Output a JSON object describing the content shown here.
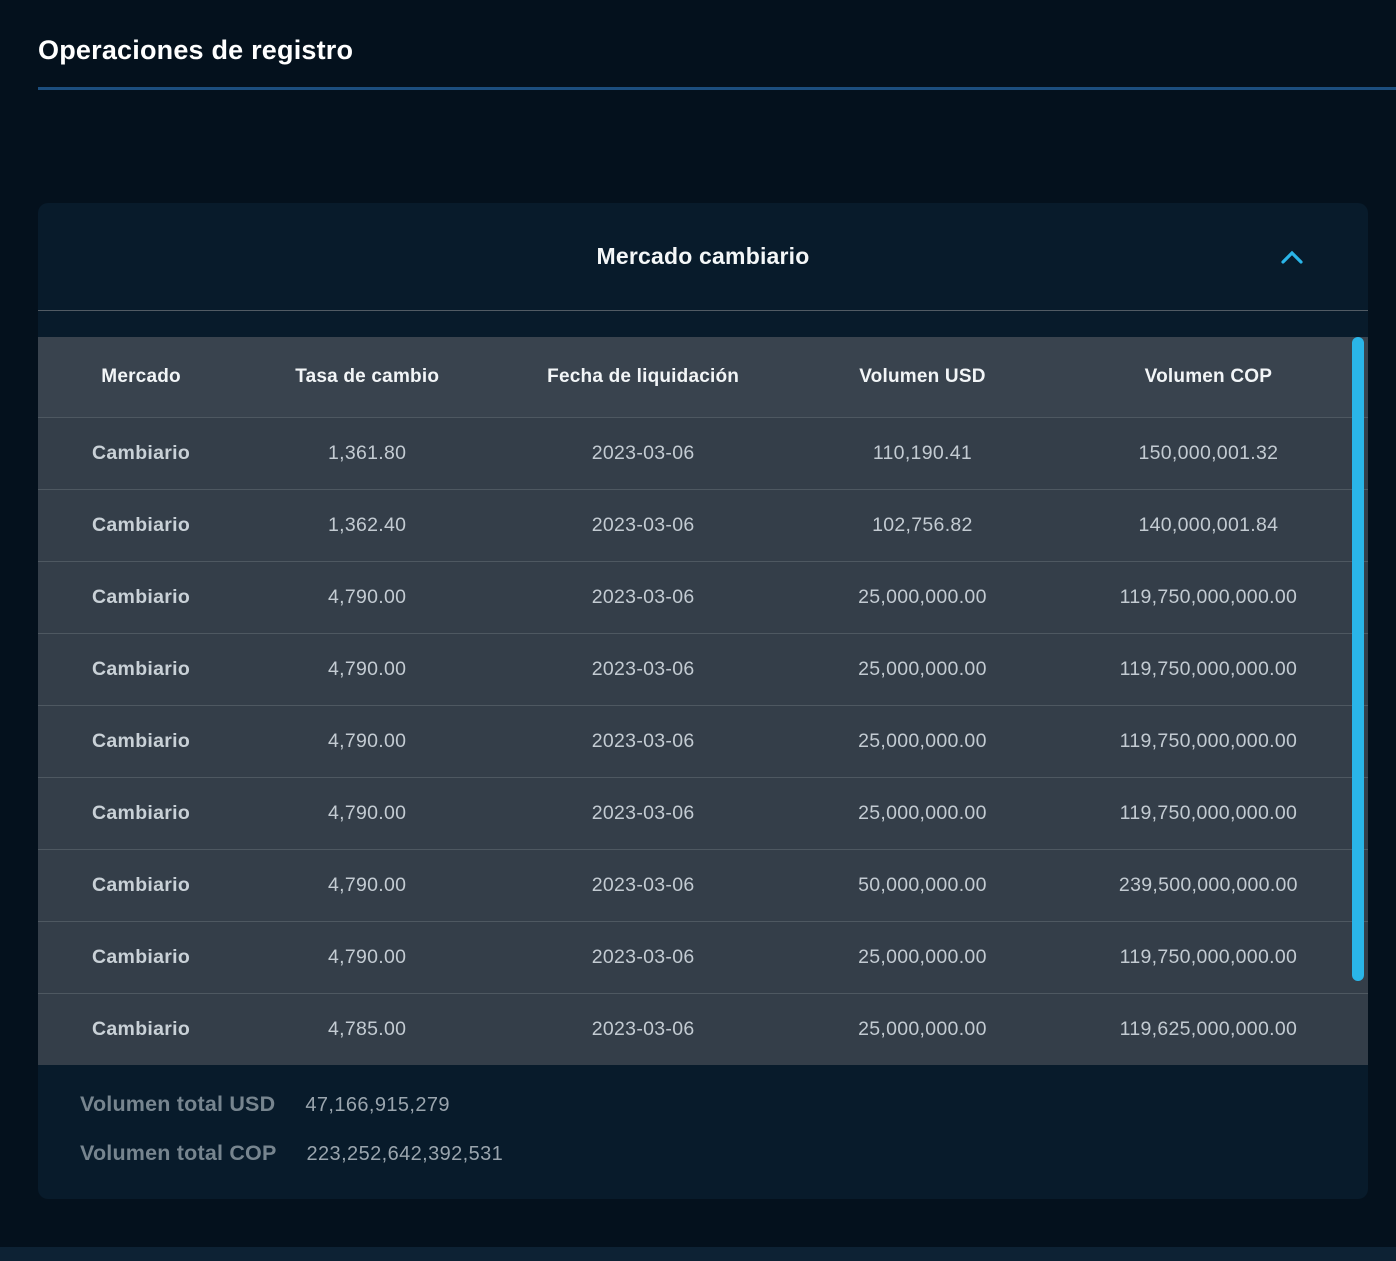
{
  "page": {
    "title": "Operaciones de registro"
  },
  "panel": {
    "title": "Mercado cambiario",
    "collapse_icon": "chevron-up",
    "accent_color": "#2ab5e8"
  },
  "table": {
    "headers": [
      "Mercado",
      "Tasa de cambio",
      "Fecha de liquidación",
      "Volumen USD",
      "Volumen COP"
    ],
    "rows": [
      [
        "Cambiario",
        "1,361.80",
        "2023-03-06",
        "110,190.41",
        "150,000,001.32"
      ],
      [
        "Cambiario",
        "1,362.40",
        "2023-03-06",
        "102,756.82",
        "140,000,001.84"
      ],
      [
        "Cambiario",
        "4,790.00",
        "2023-03-06",
        "25,000,000.00",
        "119,750,000,000.00"
      ],
      [
        "Cambiario",
        "4,790.00",
        "2023-03-06",
        "25,000,000.00",
        "119,750,000,000.00"
      ],
      [
        "Cambiario",
        "4,790.00",
        "2023-03-06",
        "25,000,000.00",
        "119,750,000,000.00"
      ],
      [
        "Cambiario",
        "4,790.00",
        "2023-03-06",
        "25,000,000.00",
        "119,750,000,000.00"
      ],
      [
        "Cambiario",
        "4,790.00",
        "2023-03-06",
        "50,000,000.00",
        "239,500,000,000.00"
      ],
      [
        "Cambiario",
        "4,790.00",
        "2023-03-06",
        "25,000,000.00",
        "119,750,000,000.00"
      ],
      [
        "Cambiario",
        "4,785.00",
        "2023-03-06",
        "25,000,000.00",
        "119,625,000,000.00"
      ]
    ]
  },
  "totals": {
    "usd_label": "Volumen total USD",
    "usd_value": "47,166,915,279",
    "cop_label": "Volumen total COP",
    "cop_value": "223,252,642,392,531"
  }
}
